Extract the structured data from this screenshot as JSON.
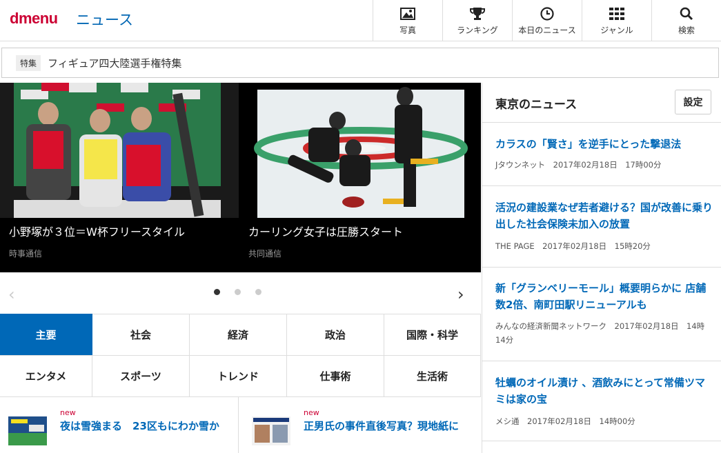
{
  "header": {
    "logo": "dmenu",
    "section": "ニュース",
    "nav": [
      {
        "label": "写真",
        "icon": "image-icon"
      },
      {
        "label": "ランキング",
        "icon": "trophy-icon"
      },
      {
        "label": "本日のニュース",
        "icon": "clock-icon"
      },
      {
        "label": "ジャンル",
        "icon": "grid-icon"
      },
      {
        "label": "検索",
        "icon": "search-icon"
      }
    ]
  },
  "feature": {
    "tag": "特集",
    "title": "フィギュア四大陸選手権特集"
  },
  "carousel": {
    "slides": [
      {
        "caption": "小野塚が３位＝W杯フリースタイル",
        "source": "時事通信"
      },
      {
        "caption": "カーリング女子は圧勝スタート",
        "source": "共同通信"
      }
    ],
    "prev": "‹",
    "next": "›",
    "dots": 3,
    "active_dot": 0
  },
  "categories": [
    {
      "label": "主要",
      "active": true
    },
    {
      "label": "社会"
    },
    {
      "label": "経済"
    },
    {
      "label": "政治"
    },
    {
      "label": "国際・科学"
    },
    {
      "label": "エンタメ"
    },
    {
      "label": "スポーツ"
    },
    {
      "label": "トレンド"
    },
    {
      "label": "仕事術"
    },
    {
      "label": "生活術"
    }
  ],
  "bottom_news": [
    {
      "badge": "new",
      "title": "夜は雪強まる　23区もにわか雪か"
    },
    {
      "badge": "new",
      "title": "正男氏の事件直後写真？現地紙に"
    }
  ],
  "sidebar": {
    "title": "東京のニュース",
    "settings_label": "設定",
    "items": [
      {
        "title": "カラスの「賢さ」を逆手にとった撃退法",
        "meta": "Jタウンネット　2017年02月18日　17時00分"
      },
      {
        "title": "活況の建設業なぜ若者避ける？国が改善に乗り出した社会保険未加入の放置",
        "meta": "THE PAGE　2017年02月18日　15時20分"
      },
      {
        "title": "新「グランベリーモール」概要明らかに 店舗数2倍、南町田駅リニューアルも",
        "meta": "みんなの経済新聞ネットワーク　2017年02月18日　14時14分"
      },
      {
        "title": "牡蠣のオイル漬け 、酒飲みにとって常備ツマミは家の宝",
        "meta": "メシ通　2017年02月18日　14時00分"
      }
    ]
  },
  "colors": {
    "brand_red": "#cc0033",
    "link_blue": "#0068b7",
    "active_tab": "#0068b7"
  }
}
